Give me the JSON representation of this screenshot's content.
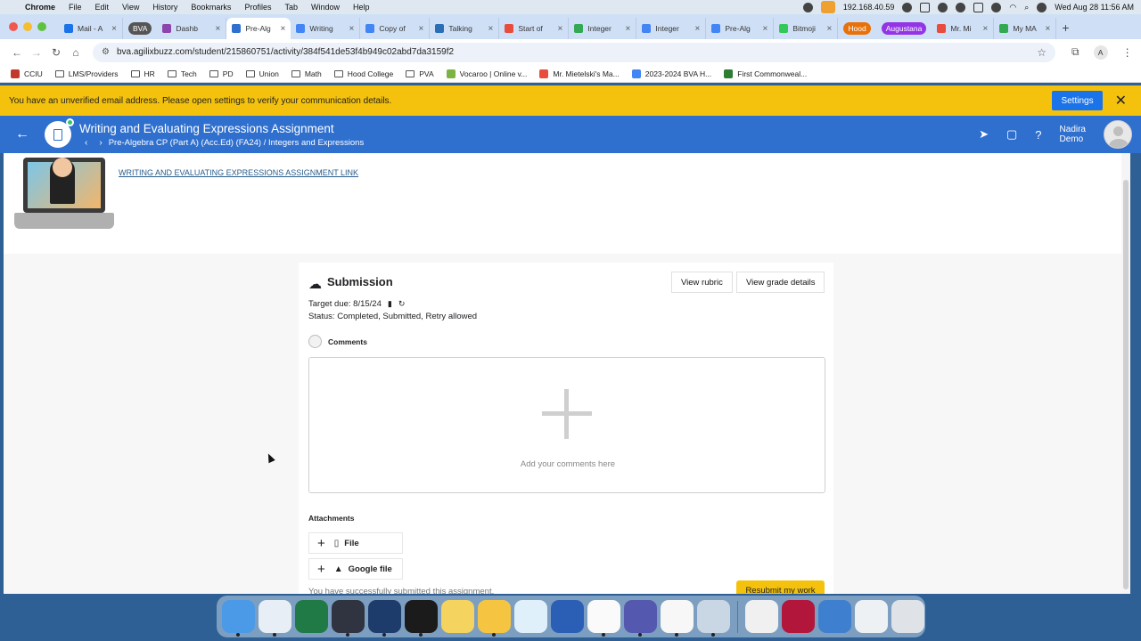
{
  "menubar": {
    "app": "Chrome",
    "items": [
      "File",
      "Edit",
      "View",
      "History",
      "Bookmarks",
      "Profiles",
      "Tab",
      "Window",
      "Help"
    ],
    "ip": "192.168.40.59",
    "datetime": "Wed Aug 28  11:56 AM"
  },
  "tabs": [
    {
      "label": "Mail - A",
      "color": "#1a73e8"
    },
    {
      "label": "BVA",
      "pill": true,
      "color": "#555"
    },
    {
      "label": "Dashb",
      "color": "#8e44ad"
    },
    {
      "label": "Pre-Alg",
      "color": "#2f6fce",
      "active": true
    },
    {
      "label": "Writing",
      "color": "#4285f4"
    },
    {
      "label": "Copy of",
      "color": "#4285f4"
    },
    {
      "label": "Talking",
      "color": "#2c6eb5"
    },
    {
      "label": "Start of",
      "color": "#e74c3c"
    },
    {
      "label": "Integer",
      "color": "#34a853"
    },
    {
      "label": "Integer",
      "color": "#4285f4"
    },
    {
      "label": "Pre-Alg",
      "color": "#4285f4"
    },
    {
      "label": "Bitmoji",
      "color": "#34c759"
    }
  ],
  "tab_groups": [
    {
      "label": "Hood",
      "color": "#e8710a"
    },
    {
      "label": "Augustana",
      "color": "#9334e6"
    }
  ],
  "tabs_after": [
    {
      "label": "Mr. Mi",
      "color": "#e74c3c"
    },
    {
      "label": "My MA",
      "color": "#34a853"
    }
  ],
  "url": "bva.agilixbuzz.com/student/215860751/activity/384f541de53f4b949c02abd7da3159f2",
  "profile_initial": "A",
  "bookmarks": [
    {
      "label": "CCIU",
      "type": "fav",
      "color": "#c0392b"
    },
    {
      "label": "LMS/Providers",
      "type": "folder"
    },
    {
      "label": "HR",
      "type": "folder"
    },
    {
      "label": "Tech",
      "type": "folder"
    },
    {
      "label": "PD",
      "type": "folder"
    },
    {
      "label": "Union",
      "type": "folder"
    },
    {
      "label": "Math",
      "type": "folder"
    },
    {
      "label": "Hood College",
      "type": "folder"
    },
    {
      "label": "PVA",
      "type": "folder"
    },
    {
      "label": "Vocaroo | Online v...",
      "type": "fav",
      "color": "#7cb342"
    },
    {
      "label": "Mr. Mietelski's Ma...",
      "type": "fav",
      "color": "#e74c3c"
    },
    {
      "label": "2023-2024 BVA H...",
      "type": "fav",
      "color": "#4285f4"
    },
    {
      "label": "First Commonweal...",
      "type": "fav",
      "color": "#2e7d32"
    }
  ],
  "banner": {
    "text": "You have an unverified email address. Please open settings to verify your communication details.",
    "button": "Settings"
  },
  "header": {
    "title": "Writing and Evaluating Expressions Assignment",
    "breadcrumb": "Pre-Algebra CP (Part A) (Acc.Ed) (FA24) / Integers and Expressions",
    "user_first": "Nadira",
    "user_last": "Demo"
  },
  "assignment_link": "WRITING AND EVALUATING EXPRESSIONS ASSIGNMENT LINK",
  "submission": {
    "title": "Submission",
    "view_rubric": "View rubric",
    "view_grade": "View grade details",
    "due": "Target due: 8/15/24",
    "status": "Status: Completed, Submitted, Retry allowed",
    "comments_label": "Comments",
    "comments_placeholder": "Add your comments here",
    "attachments_label": "Attachments",
    "file_btn": "File",
    "google_btn": "Google file",
    "success": "You have successfully submitted this assignment.",
    "resubmit": "Resubmit my work"
  },
  "dock": [
    {
      "name": "finder-icon",
      "color": "#4a9ae8",
      "running": true
    },
    {
      "name": "chrome-icon",
      "color": "#e8eef5",
      "running": true
    },
    {
      "name": "excel-icon",
      "color": "#1f7a45",
      "running": false
    },
    {
      "name": "screencast-icon",
      "color": "#2f3440",
      "running": true
    },
    {
      "name": "phone-icon",
      "color": "#1d3b6b",
      "running": true
    },
    {
      "name": "spreadsheet-app-icon",
      "color": "#1b1b1b",
      "running": true
    },
    {
      "name": "notes-icon",
      "color": "#f4d35e",
      "running": false
    },
    {
      "name": "camera-icon",
      "color": "#f5c542",
      "running": true
    },
    {
      "name": "refresh-app-icon",
      "color": "#dff0fa",
      "running": false
    },
    {
      "name": "word-icon",
      "color": "#2b5fb5",
      "running": false
    },
    {
      "name": "flashcard-app-icon",
      "color": "#fafafa",
      "running": true
    },
    {
      "name": "teams-icon",
      "color": "#5558af",
      "running": true
    },
    {
      "name": "acrobat-icon",
      "color": "#f7f7f7",
      "running": true
    },
    {
      "name": "quicktime-icon",
      "color": "#c9d6e3",
      "running": true
    },
    {
      "name": "divider",
      "color": ""
    },
    {
      "name": "installer-icon",
      "color": "#f0f0f0",
      "running": false
    },
    {
      "name": "red-app-icon",
      "color": "#b3163b",
      "running": false
    },
    {
      "name": "globe-icon",
      "color": "#3f7fd0",
      "running": false
    },
    {
      "name": "window-icon",
      "color": "#eef1f4",
      "running": false
    },
    {
      "name": "trash-icon",
      "color": "#dfe3e7",
      "running": false
    }
  ]
}
